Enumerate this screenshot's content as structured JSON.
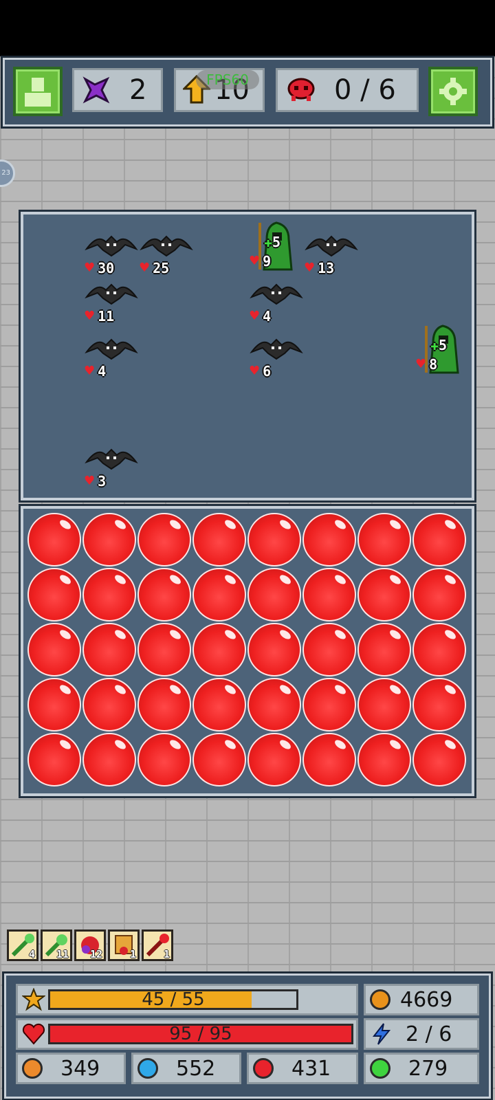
{
  "top_hud": {
    "gems": "2",
    "level": "10",
    "fps": "FPS60",
    "kills": "0 / 6"
  },
  "side_tab": "23",
  "enemies": [
    {
      "type": "bat",
      "hp": "30"
    },
    {
      "type": "bat",
      "hp": "25"
    },
    {
      "type": "shaman",
      "hp": "9",
      "heal": "5"
    },
    {
      "type": "bat",
      "hp": "13"
    },
    {
      "type": "bat",
      "hp": "11"
    },
    {
      "type": "bat",
      "hp": "4"
    },
    {
      "type": "bat",
      "hp": "4"
    },
    {
      "type": "bat",
      "hp": "6"
    },
    {
      "type": "shaman",
      "hp": "8",
      "heal": "5"
    },
    {
      "type": "bat",
      "hp": "3"
    }
  ],
  "board": {
    "rows": 5,
    "cols": 8,
    "orb_color": "red"
  },
  "items": [
    {
      "icon": "green-wand-icon",
      "count": "4"
    },
    {
      "icon": "green-key-icon",
      "count": "11"
    },
    {
      "icon": "red-potion-icon",
      "count": "12"
    },
    {
      "icon": "scroll-icon",
      "count": "1"
    },
    {
      "icon": "red-wand-icon",
      "count": "1"
    }
  ],
  "bottom_hud": {
    "xp": "45 / 55",
    "xp_fraction": 0.818,
    "coins": "4669",
    "health": "95 / 95",
    "health_fraction": 1.0,
    "energy": "2 / 6",
    "orange": "349",
    "blue": "552",
    "red": "431",
    "green": "279"
  },
  "colors": {
    "panel": "#3f5368",
    "field": "#4d6379",
    "hud_button": "#6abf3d",
    "xp_bar": "#f0a81c",
    "health_bar": "#e8232c"
  }
}
